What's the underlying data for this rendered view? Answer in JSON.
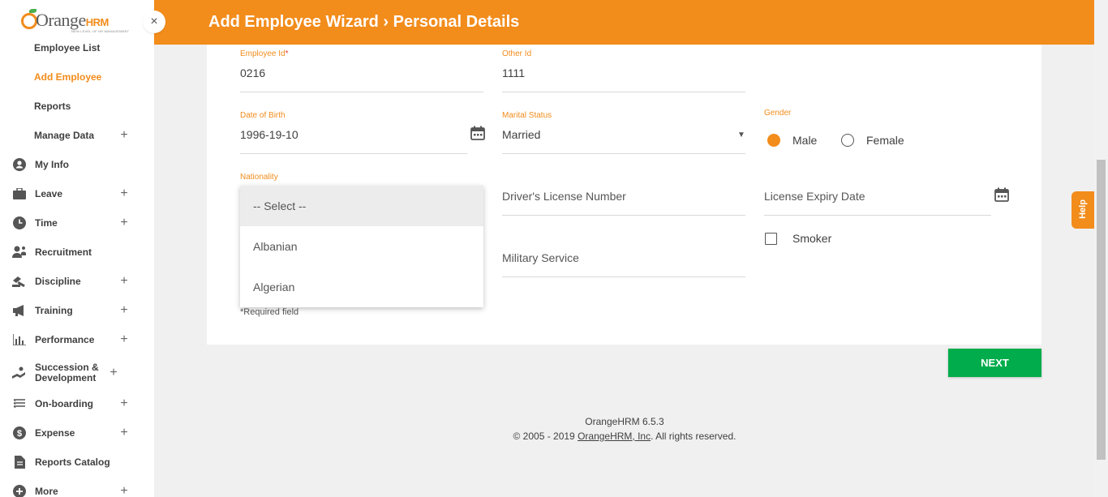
{
  "app": {
    "logo_text": "Orange",
    "logo_suffix": "HRM",
    "logo_tagline": "NEW LEVEL OF HR MANAGEMENT",
    "close_glyph": "×"
  },
  "header": {
    "title": "Add Employee Wizard › Personal Details"
  },
  "sidebar": {
    "items": [
      {
        "label": "Employee List",
        "icon": "none"
      },
      {
        "label": "Add Employee",
        "icon": "none",
        "active": true
      },
      {
        "label": "Reports",
        "icon": "none"
      },
      {
        "label": "Manage Data",
        "icon": "none",
        "expand": "+"
      },
      {
        "label": "My Info",
        "icon": "user-icon"
      },
      {
        "label": "Leave",
        "icon": "briefcase-icon",
        "expand": "+"
      },
      {
        "label": "Time",
        "icon": "clock-icon",
        "expand": "+"
      },
      {
        "label": "Recruitment",
        "icon": "recruitment-icon"
      },
      {
        "label": "Discipline",
        "icon": "discipline-icon",
        "expand": "+"
      },
      {
        "label": "Training",
        "icon": "megaphone-icon",
        "expand": "+"
      },
      {
        "label": "Performance",
        "icon": "bar-chart-icon",
        "expand": "+"
      },
      {
        "label": "Succession & Development",
        "icon": "succession-icon",
        "expand": "+"
      },
      {
        "label": "On-boarding",
        "icon": "onboarding-icon",
        "expand": "+"
      },
      {
        "label": "Expense",
        "icon": "dollar-icon",
        "expand": "+"
      },
      {
        "label": "Reports Catalog",
        "icon": "document-icon"
      },
      {
        "label": "More",
        "icon": "plus-circle-icon",
        "expand": "+"
      }
    ]
  },
  "form": {
    "employee_id": {
      "label": "Employee Id",
      "required_mark": "*",
      "value": "0216"
    },
    "other_id": {
      "label": "Other Id",
      "value": "1111"
    },
    "date_of_birth": {
      "label": "Date of Birth",
      "value": "1996-19-10"
    },
    "marital_status": {
      "label": "Marital Status",
      "value": "Married",
      "arrow": "▼"
    },
    "gender": {
      "label": "Gender",
      "options": [
        "Male",
        "Female"
      ],
      "selected": "Male"
    },
    "nationality": {
      "label": "Nationality",
      "options": [
        "-- Select --",
        "Albanian",
        "Algerian"
      ],
      "selected": "-- Select --"
    },
    "drivers_license": {
      "placeholder": "Driver's License Number"
    },
    "license_expiry": {
      "placeholder": "License Expiry Date"
    },
    "smoker": {
      "label": "Smoker",
      "checked": false
    },
    "military_service": {
      "placeholder": "Military Service"
    },
    "required_note": "*Required field"
  },
  "actions": {
    "next_label": "NEXT"
  },
  "footer": {
    "version": "OrangeHRM 6.5.3",
    "copyright_prefix": "© 2005 - 2019 ",
    "copyright_link": "OrangeHRM, Inc",
    "copyright_suffix": ". All rights reserved."
  },
  "help": {
    "label": "Help"
  },
  "colors": {
    "accent": "#f28c1b",
    "next_button": "#00ac4b"
  }
}
